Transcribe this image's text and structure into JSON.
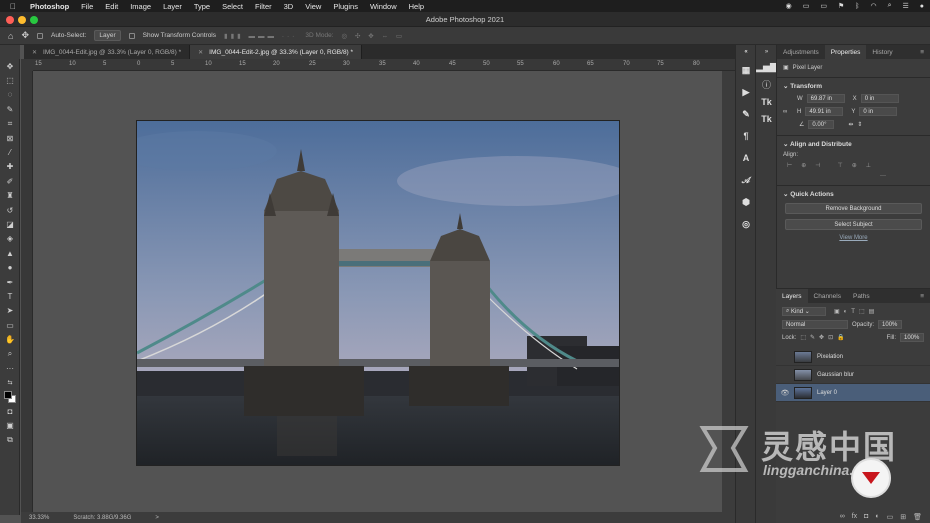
{
  "menubar": {
    "app": "Photoshop",
    "items": [
      "File",
      "Edit",
      "Image",
      "Layer",
      "Type",
      "Select",
      "Filter",
      "3D",
      "View",
      "Plugins",
      "Window",
      "Help"
    ]
  },
  "window": {
    "title": "Adobe Photoshop 2021"
  },
  "options": {
    "auto_select_label": "Auto-Select:",
    "auto_select_value": "Layer",
    "show_transform_label": "Show Transform Controls",
    "mode_3d": "3D Mode:"
  },
  "tabs": [
    {
      "label": "IMG_0044-Edit.jpg @ 33.3% (Layer 0, RGB/8) *"
    },
    {
      "label": "IMG_0044-Edit-2.jpg @ 33.3% (Layer 0, RGB/8) *"
    }
  ],
  "ruler": {
    "labels": [
      "15",
      "10",
      "5",
      "0",
      "5",
      "10",
      "15",
      "20",
      "25",
      "30",
      "35",
      "40",
      "45",
      "50",
      "55",
      "60",
      "65",
      "70",
      "75",
      "80"
    ]
  },
  "status": {
    "zoom": "33.33%",
    "scratch": "Scratch: 3.88G/9.36G",
    "arrow": ">"
  },
  "panel": {
    "tabs": [
      "Adjustments",
      "Properties",
      "History"
    ],
    "pixel_layer": "Pixel Layer",
    "transform": {
      "title": "Transform",
      "w_label": "W",
      "w_value": "69.87 in",
      "x_label": "X",
      "x_value": "0 in",
      "h_label": "H",
      "h_value": "49.91 in",
      "y_label": "Y",
      "y_value": "0 in",
      "angle_value": "0.00°"
    },
    "align": {
      "title": "Align and Distribute",
      "align_label": "Align:"
    },
    "quick": {
      "title": "Quick Actions",
      "remove_bg": "Remove Background",
      "select_subject": "Select Subject",
      "view_more": "View More"
    }
  },
  "layers_panel": {
    "tabs": [
      "Layers",
      "Channels",
      "Paths"
    ],
    "kind": "Kind",
    "blend": "Normal",
    "opacity_label": "Opacity:",
    "opacity": "100%",
    "lock_label": "Lock:",
    "fill_label": "Fill:",
    "fill": "100%",
    "layers": [
      {
        "name": "Pixelation",
        "visible": false,
        "selected": false
      },
      {
        "name": "Gaussian blur",
        "visible": false,
        "selected": false
      },
      {
        "name": "Layer 0",
        "visible": true,
        "selected": true
      }
    ]
  },
  "watermark": {
    "brand": "灵感中国",
    "url": "lingganchina.com"
  },
  "colors": {
    "selection": "#4a5e79",
    "panel_bg": "#3c3c3c",
    "canvas_bg": "#535353"
  }
}
